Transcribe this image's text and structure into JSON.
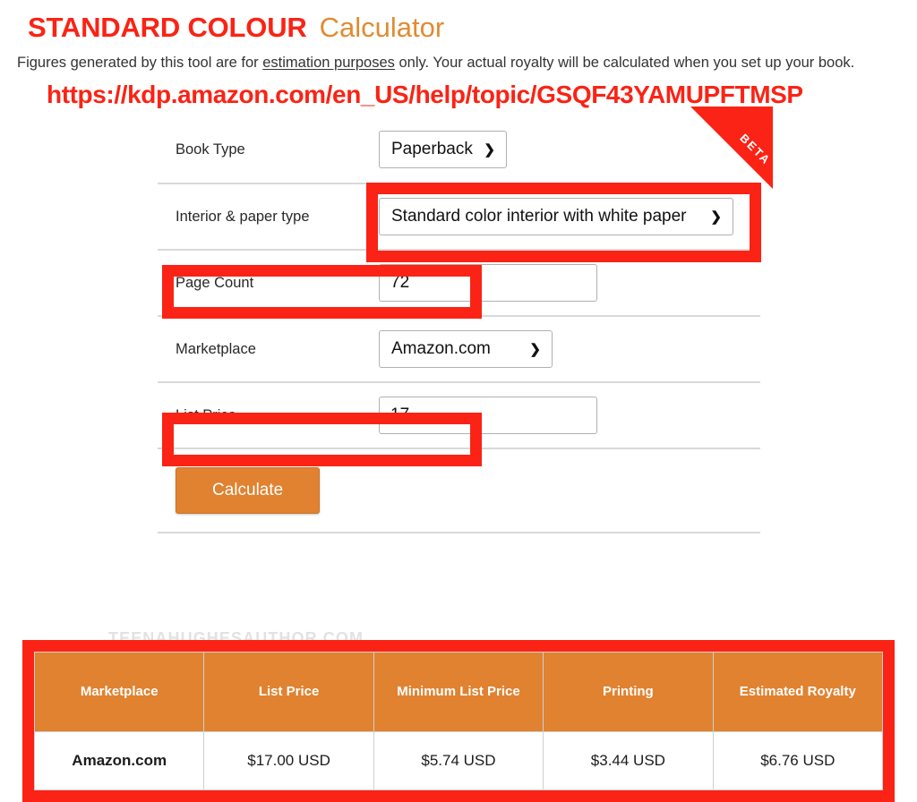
{
  "header": {
    "title_strong": "STANDARD COLOUR",
    "title_accent": "Calculator",
    "disclaimer_part1": "Figures generated by this tool are for ",
    "disclaimer_link": "estimation purposes",
    "disclaimer_part2": " only. Your actual royalty will be calculated when you set up your book.",
    "url": "https://kdp.amazon.com/en_US/help/topic/GSQF43YAMUPFTMSP",
    "accent_red": "#fa2315",
    "accent_orange": "#e08b32"
  },
  "ribbon": {
    "label": "BETA",
    "color": "#fa2315"
  },
  "form": {
    "rows": [
      {
        "label": "Book Type",
        "value": "Paperback",
        "control": "select"
      },
      {
        "label": "Interior & paper type",
        "value": "Standard color interior with white paper",
        "control": "select"
      },
      {
        "label": "Page Count",
        "value": "72",
        "control": "input"
      },
      {
        "label": "Marketplace",
        "value": "Amazon.com",
        "control": "select"
      },
      {
        "label": "List Price",
        "value": "17",
        "control": "input"
      }
    ],
    "book_type_options": [
      "Paperback"
    ],
    "interior_options": [
      "Standard color interior with white paper"
    ],
    "marketplace_options": [
      "Amazon.com"
    ],
    "calculate_label": "Calculate",
    "chevron_icon": "⌄"
  },
  "watermark": {
    "text": "TEENAHUGHESAUTHOR.COM"
  },
  "results": {
    "headers": [
      "Marketplace",
      "List Price",
      "Minimum List Price",
      "Printing",
      "Estimated Royalty"
    ],
    "rows": [
      [
        "Amazon.com",
        "$17.00 USD",
        "$5.74 USD",
        "$3.44 USD",
        "$6.76 USD"
      ]
    ],
    "header_bg": "#e08230"
  }
}
